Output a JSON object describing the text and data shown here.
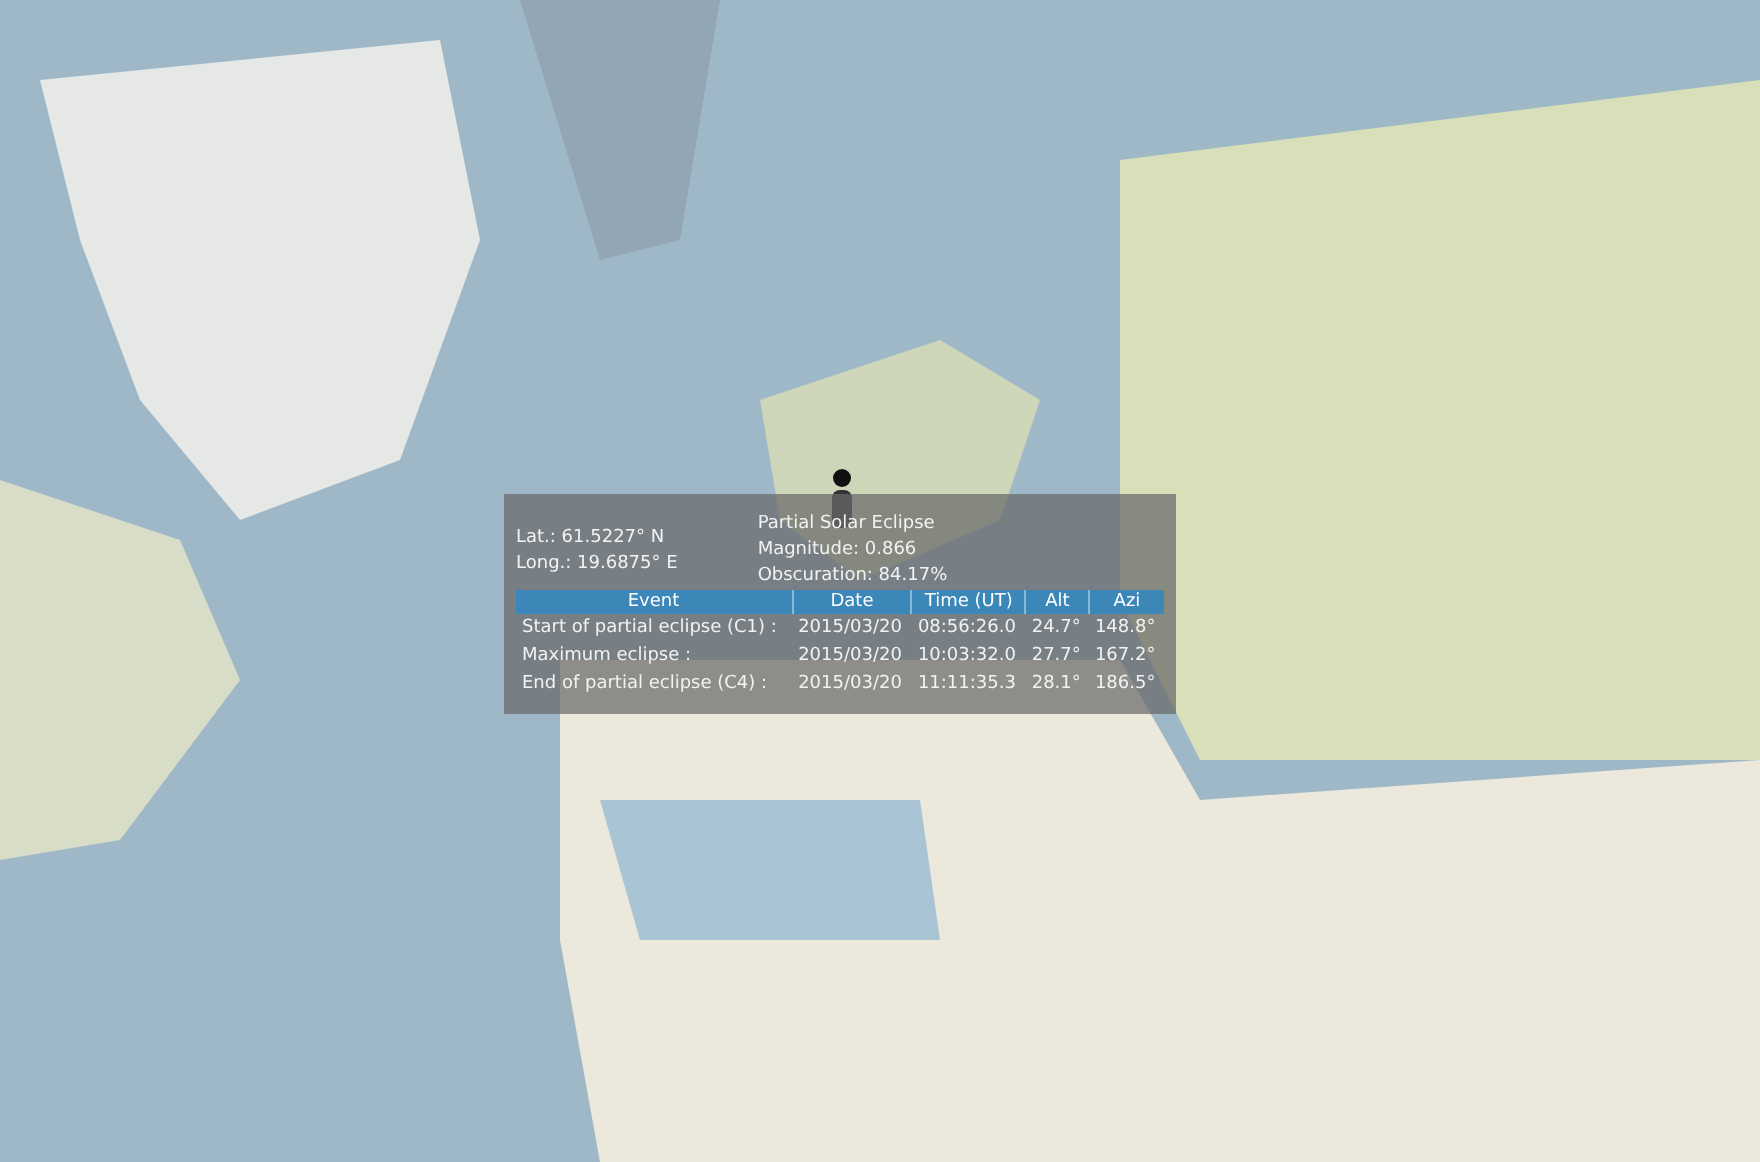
{
  "popup": {
    "lat": "Lat.: 61.5227° N",
    "long": "Long.: 19.6875° E",
    "title": "Partial Solar Eclipse",
    "magnitude": "Magnitude: 0.866",
    "obscuration": "Obscuration: 84.17%",
    "columns": [
      "Event",
      "Date",
      "Time (UT)",
      "Alt",
      "Azi"
    ],
    "rows": [
      {
        "cells": [
          "Start of partial eclipse (C1) :",
          "2015/03/20",
          "08:56:26.0",
          "24.7°",
          "148.8°"
        ]
      },
      {
        "cells": [
          "Maximum eclipse :",
          "2015/03/20",
          "10:03:32.0",
          "27.7°",
          "167.2°"
        ]
      },
      {
        "cells": [
          "End of partial eclipse (C4) :",
          "2015/03/20",
          "11:11:35.3",
          "28.1°",
          "186.5°"
        ]
      }
    ]
  }
}
